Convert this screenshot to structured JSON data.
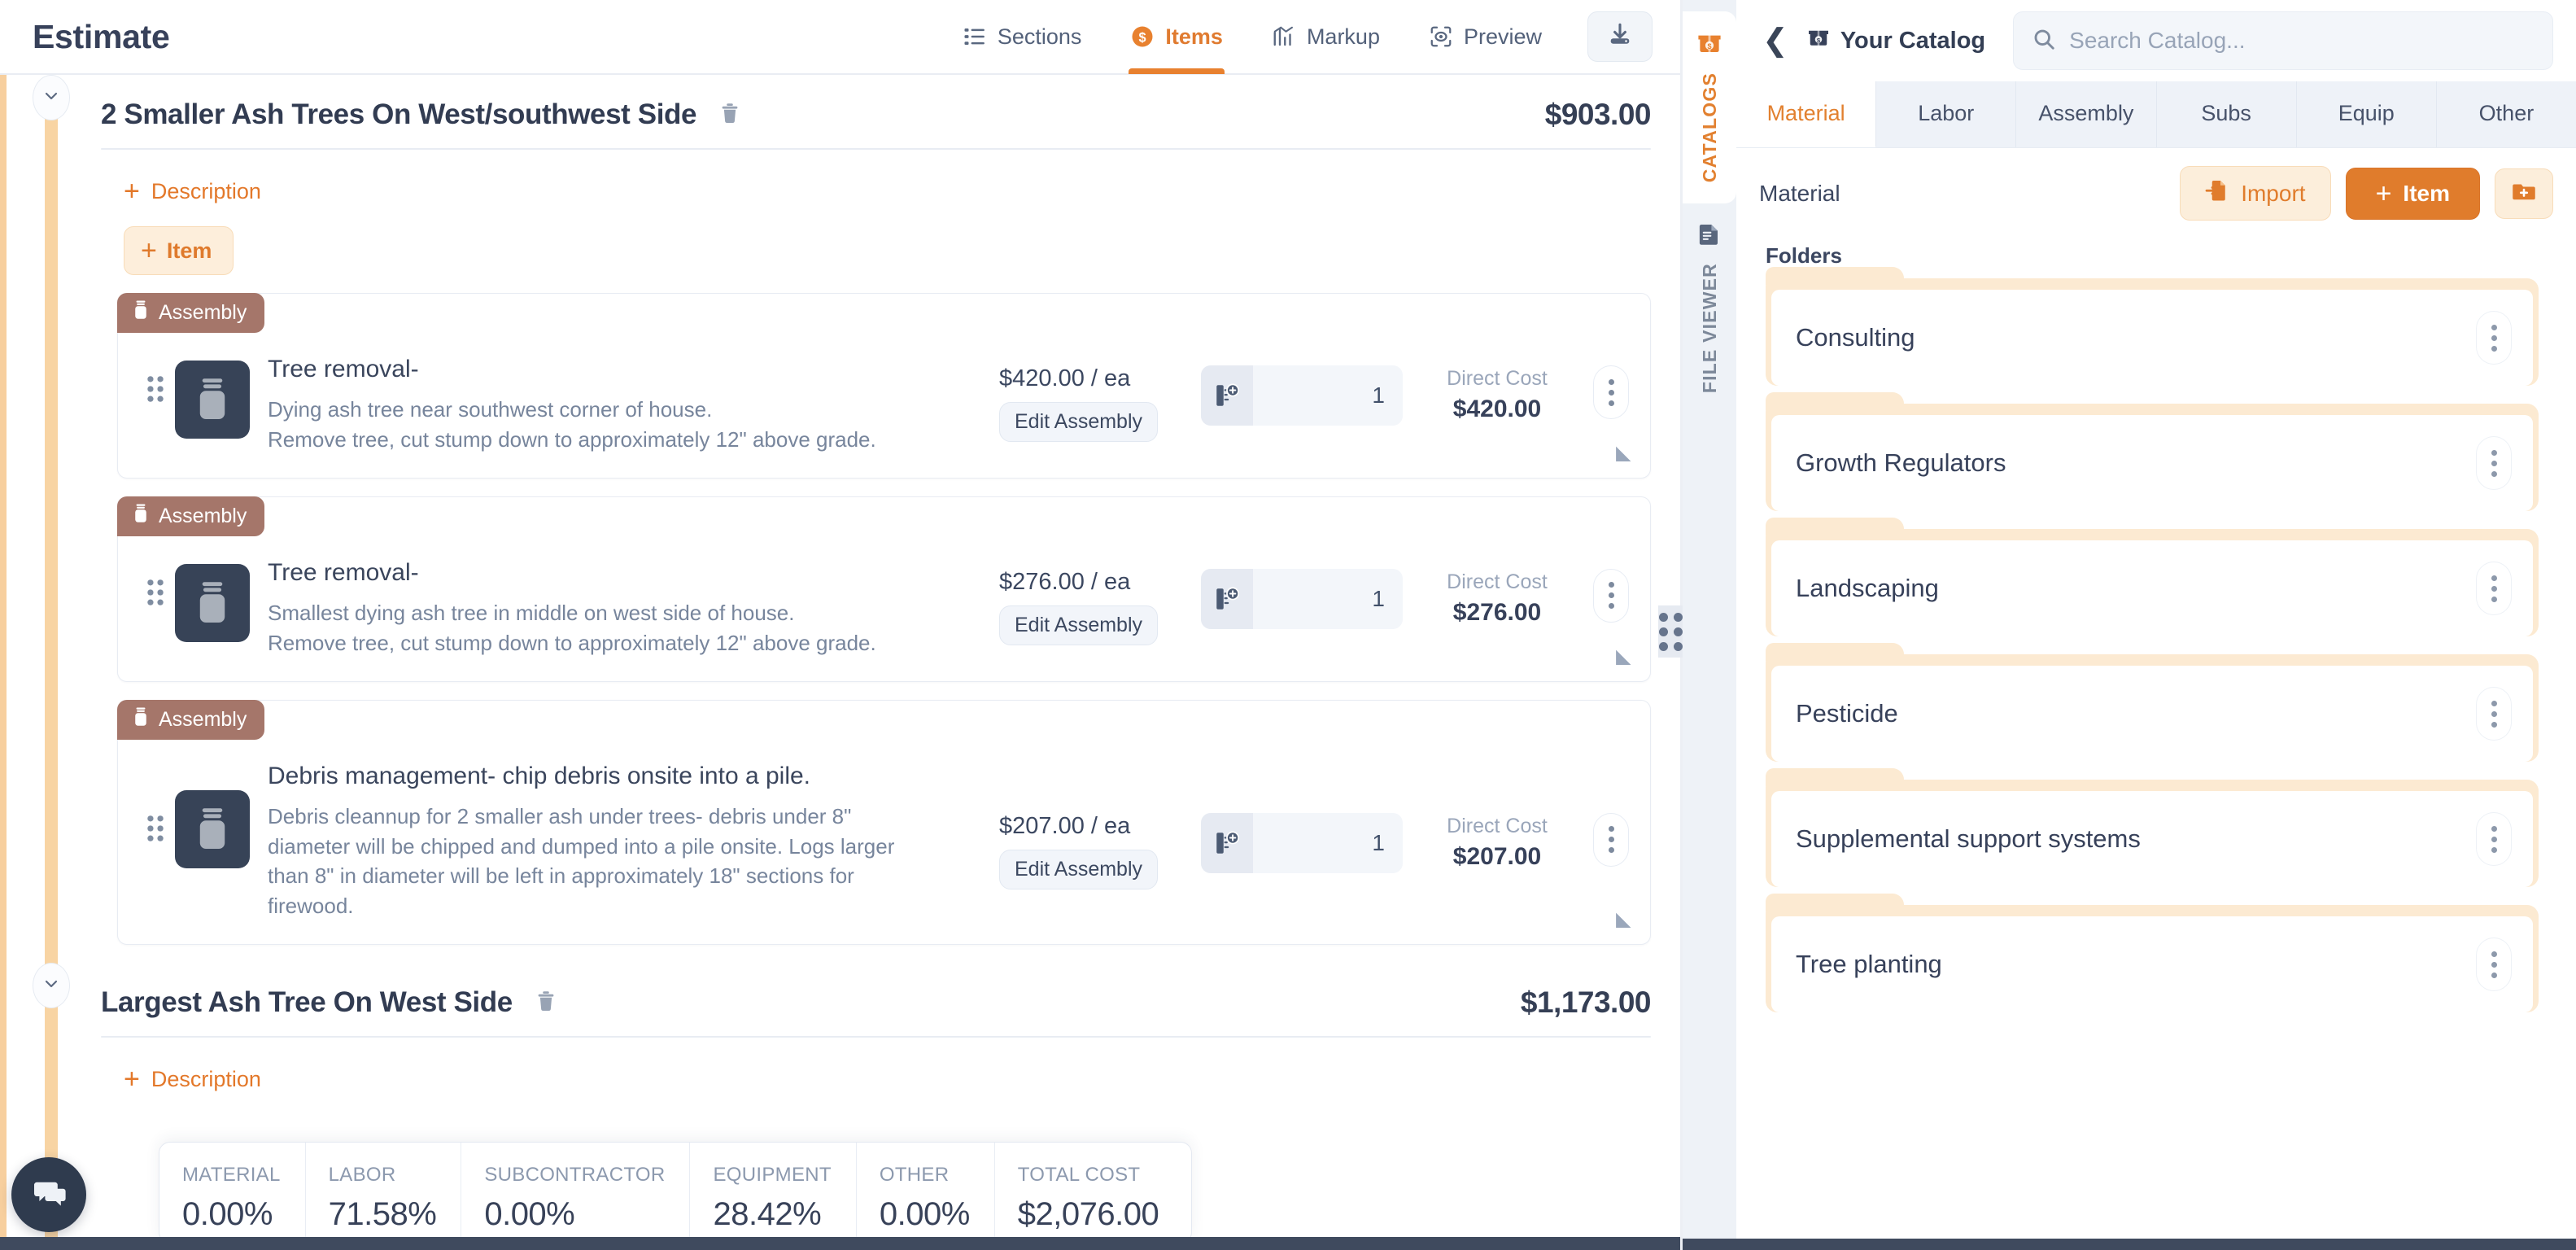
{
  "app": {
    "title": "Estimate"
  },
  "topnav": {
    "items": [
      {
        "label": "Sections",
        "icon": "sections-icon",
        "active": false
      },
      {
        "label": "Items",
        "icon": "dollar-circle-icon",
        "active": true
      },
      {
        "label": "Markup",
        "icon": "chart-up-icon",
        "active": false
      },
      {
        "label": "Preview",
        "icon": "eye-scan-icon",
        "active": false
      }
    ],
    "download_button": "download-icon"
  },
  "sections": [
    {
      "title": "2 Smaller Ash Trees On West/southwest Side",
      "amount": "$903.00",
      "add_description_label": "Description",
      "add_item_label": "Item",
      "items": [
        {
          "badge": "Assembly",
          "name": "Tree removal-",
          "description": "Dying ash tree near southwest corner of house.\nRemove tree, cut stump down to approximately 12\" above grade.",
          "unit_price": "$420.00 / ea",
          "edit_label": "Edit Assembly",
          "quantity": "1",
          "cost_label": "Direct Cost",
          "cost_value": "$420.00"
        },
        {
          "badge": "Assembly",
          "name": "Tree removal-",
          "description": "Smallest dying ash tree in middle on west side of house.\nRemove tree, cut stump down to approximately 12\" above grade.",
          "unit_price": "$276.00 / ea",
          "edit_label": "Edit Assembly",
          "quantity": "1",
          "cost_label": "Direct Cost",
          "cost_value": "$276.00"
        },
        {
          "badge": "Assembly",
          "name": "Debris management- chip debris onsite into a pile.",
          "description": "Debris cleannup for 2 smaller ash under trees- debris under 8\" diameter will be chipped and dumped into a pile onsite. Logs larger than 8\" in diameter will be left in approximately 18\" sections for firewood.",
          "unit_price": "$207.00 / ea",
          "edit_label": "Edit Assembly",
          "quantity": "1",
          "cost_label": "Direct Cost",
          "cost_value": "$207.00"
        }
      ]
    },
    {
      "title": "Largest Ash Tree On West Side",
      "amount": "$1,173.00",
      "add_description_label": "Description"
    }
  ],
  "totals": [
    {
      "label": "MATERIAL",
      "value": "0.00%"
    },
    {
      "label": "LABOR",
      "value": "71.58%"
    },
    {
      "label": "SUBCONTRACTOR",
      "value": "0.00%"
    },
    {
      "label": "EQUIPMENT",
      "value": "28.42%"
    },
    {
      "label": "OTHER",
      "value": "0.00%"
    },
    {
      "label": "TOTAL COST",
      "value": "$2,076.00"
    }
  ],
  "chat": {
    "icon": "chat-bubbles-icon"
  },
  "rightpanel": {
    "vtabs": [
      {
        "label": "CATALOGS",
        "icon": "catalog-box-icon",
        "active": true
      },
      {
        "label": "FILE VIEWER",
        "icon": "document-icon",
        "active": false
      }
    ],
    "header": {
      "back": "chevron-left-icon",
      "title": "Your Catalog",
      "title_icon": "catalog-box-icon",
      "search_placeholder": "Search Catalog..."
    },
    "tabs": [
      {
        "label": "Material",
        "active": true
      },
      {
        "label": "Labor",
        "active": false
      },
      {
        "label": "Assembly",
        "active": false
      },
      {
        "label": "Subs",
        "active": false
      },
      {
        "label": "Equip",
        "active": false
      },
      {
        "label": "Other",
        "active": false
      }
    ],
    "actions": {
      "section_label": "Material",
      "import_label": "Import",
      "item_label": "Item",
      "add_folder_icon": "folder-plus-icon"
    },
    "folders_heading": "Folders",
    "folders": [
      {
        "name": "Consulting"
      },
      {
        "name": "Growth Regulators"
      },
      {
        "name": "Landscaping"
      },
      {
        "name": "Pesticide"
      },
      {
        "name": "Supplemental support systems"
      },
      {
        "name": "Tree planting"
      }
    ]
  },
  "colors": {
    "accent": "#e07c2c",
    "accent_soft": "#fceedb",
    "badge": "#a5766a",
    "thumb": "#374357",
    "dark_text": "#37415a"
  }
}
